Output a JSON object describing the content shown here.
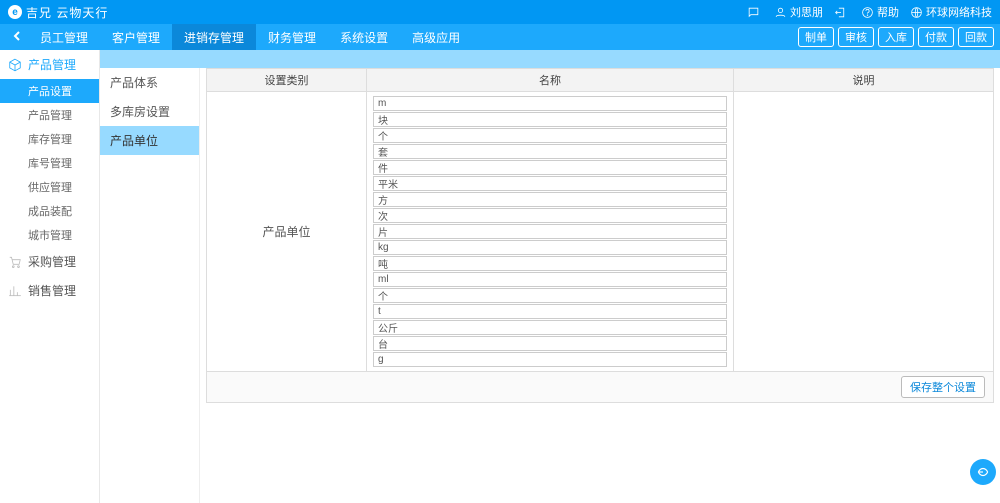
{
  "header": {
    "brand": "吉兄 云物天行",
    "user_name": "刘思朋",
    "help_label": "帮助",
    "company": "环球网络科技"
  },
  "nav": {
    "tabs": [
      "员工管理",
      "客户管理",
      "进销存管理",
      "财务管理",
      "系统设置",
      "高级应用"
    ],
    "active_index": 2,
    "buttons": [
      "制单",
      "审核",
      "入库",
      "付款",
      "回款"
    ]
  },
  "sidebar": {
    "groups": [
      {
        "label": "产品管理",
        "icon": "cube-icon",
        "active": true,
        "subs": [
          "产品设置",
          "产品管理",
          "库存管理",
          "库号管理",
          "供应管理",
          "成品装配",
          "城市管理"
        ],
        "sub_active_index": 0
      },
      {
        "label": "采购管理",
        "icon": "cart-icon"
      },
      {
        "label": "销售管理",
        "icon": "chart-icon"
      }
    ]
  },
  "sub_sidebar": {
    "items": [
      "产品体系",
      "多库房设置",
      "产品单位"
    ],
    "active_index": 2
  },
  "table": {
    "headers": [
      "设置类别",
      "名称",
      "说明"
    ],
    "row_label": "产品单位",
    "units": [
      "m",
      "块",
      "个",
      "套",
      "件",
      "平米",
      "方",
      "次",
      "片",
      "kg",
      "吨",
      "ml",
      "个",
      "t",
      "公斤",
      "台",
      "g"
    ],
    "save_label": "保存整个设置"
  }
}
